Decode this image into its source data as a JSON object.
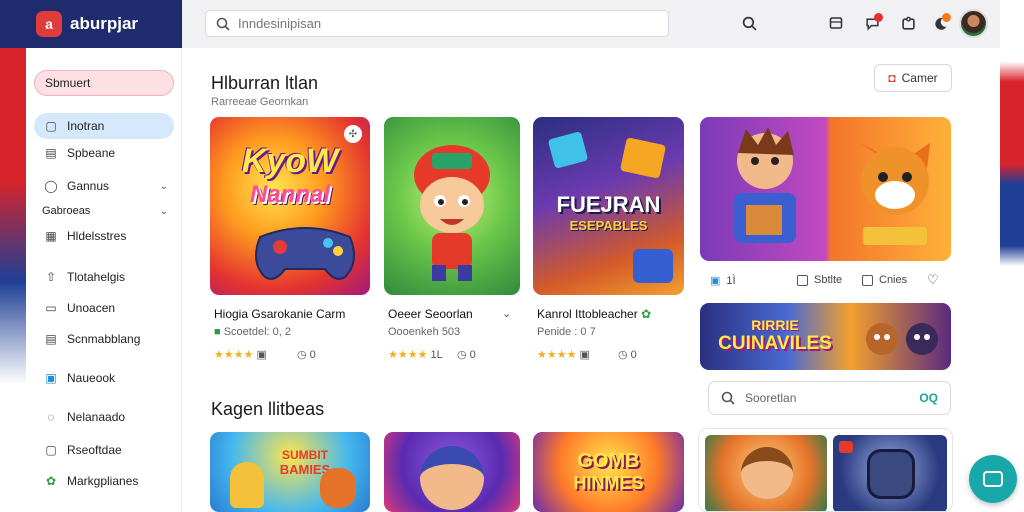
{
  "brand": {
    "name": "aburpjar",
    "logo_glyph": "a"
  },
  "search": {
    "placeholder": "Inndesinipisan"
  },
  "sidebar": {
    "items": [
      {
        "label": "Sbmuert",
        "icon": "",
        "style": "primary"
      },
      {
        "label": "Inotran",
        "icon": "square-icon",
        "style": "active"
      },
      {
        "label": "Spbeane",
        "icon": "calendar-icon",
        "style": ""
      },
      {
        "label": "Gannus",
        "icon": "ring-icon",
        "style": "",
        "chevron": true
      },
      {
        "label": "Gabroeas",
        "icon": "",
        "style": "section",
        "chevron": true
      },
      {
        "label": "Hldelsstres",
        "icon": "grid-icon",
        "style": ""
      },
      {
        "label": "Tlotahelgis",
        "icon": "upload-icon",
        "style": ""
      },
      {
        "label": "Unoacen",
        "icon": "folder-icon",
        "style": ""
      },
      {
        "label": "Scnmabblang",
        "icon": "calendar-icon",
        "style": ""
      },
      {
        "label": "Naueook",
        "icon": "photo-icon",
        "style": ""
      },
      {
        "label": "Nelanaado",
        "icon": "drop-icon",
        "style": ""
      },
      {
        "label": "Rseoftdae",
        "icon": "box-icon",
        "style": ""
      },
      {
        "label": "Markgplianes",
        "icon": "leaf-icon",
        "style": ""
      }
    ]
  },
  "main": {
    "title": "Hlburran ltlan",
    "subtitle": "Rarreeae Geornkan",
    "camer_button": "Camer",
    "section2_title": "Kagen llitbeas",
    "search2_placeholder": "Sooretlan",
    "search2_tail": "OQ"
  },
  "cards": [
    {
      "art_top": "KyoW",
      "art_bottom": "Nannal",
      "title": "Hiogia Gsarokanie Carm",
      "meta": "Scoetdel: 0, 2",
      "stars": "★★★★",
      "rating_extra": "",
      "count": "0"
    },
    {
      "art_top": "",
      "art_bottom": "",
      "title": "Oeeer Seoorlan",
      "meta": "Oooenkeh 503",
      "stars": "★★★★",
      "rating_extra": "1L",
      "count": "0"
    },
    {
      "art_top": "FUEJRAN",
      "art_bottom": "ESEPABLES",
      "title": "Kanrol Ittobleacher",
      "meta": "Penide : 0 7",
      "stars": "★★★★",
      "rating_extra": "",
      "count": "0"
    }
  ],
  "right_panel": {
    "row_items": [
      "1Ì",
      "Sbtlte",
      "Cnies"
    ],
    "banner_top": "RIRRIE",
    "banner_bottom": "CUINAVILES"
  },
  "bottom_cards": [
    {
      "art_top": "SUMBIT",
      "art_bottom": "BAMIES"
    },
    {
      "art_top": "",
      "art_bottom": ""
    },
    {
      "art_top": "GOMB",
      "art_bottom": "HINMES"
    }
  ]
}
